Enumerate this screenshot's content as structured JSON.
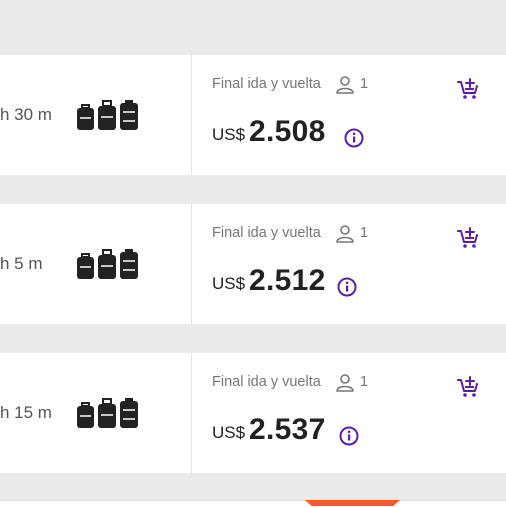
{
  "colors": {
    "accent": "#5b1fa6",
    "text": "#222222",
    "muted": "#777777",
    "page_bg": "#ebebeb",
    "highlight": "#f25a3c"
  },
  "results": [
    {
      "duration": "h 30 m",
      "label": "Final ida y vuelta",
      "passengers": "1",
      "currency": "US$",
      "price": "2.508",
      "bag_icon": "luggage-icon",
      "cart_icon": "add-to-cart-icon",
      "info_icon": "info-icon"
    },
    {
      "duration": "h 5 m",
      "label": "Final ida y vuelta",
      "passengers": "1",
      "currency": "US$",
      "price": "2.512",
      "bag_icon": "luggage-icon",
      "cart_icon": "add-to-cart-icon",
      "info_icon": "info-icon"
    },
    {
      "duration": "h 15 m",
      "label": "Final ida y vuelta",
      "passengers": "1",
      "currency": "US$",
      "price": "2.537",
      "bag_icon": "luggage-icon",
      "cart_icon": "add-to-cart-icon",
      "info_icon": "info-icon"
    }
  ]
}
